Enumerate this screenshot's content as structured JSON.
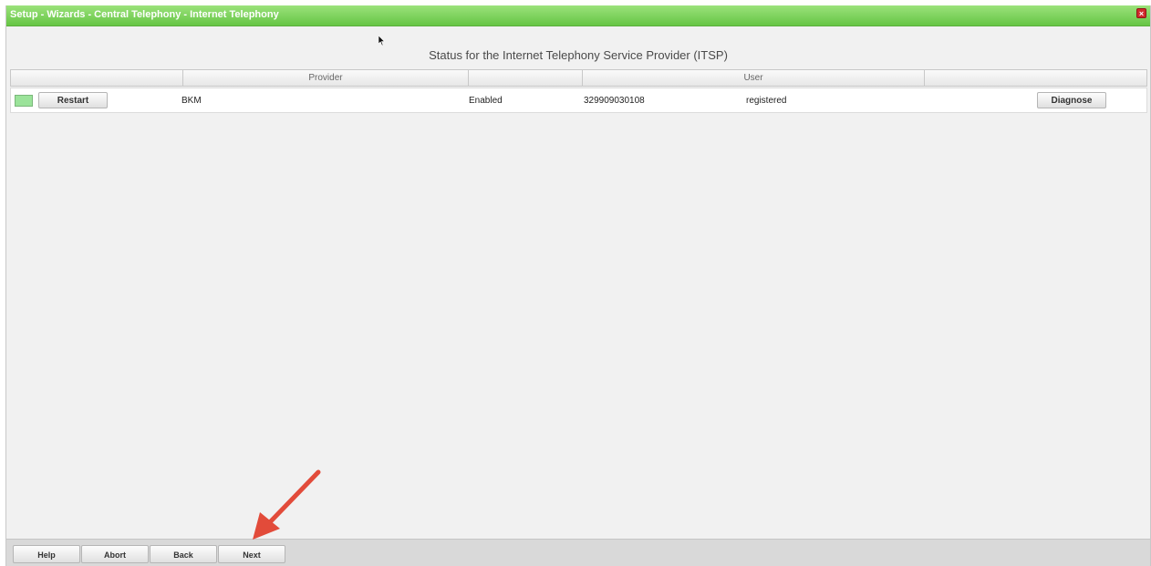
{
  "window": {
    "title": "Setup - Wizards - Central Telephony - Internet Telephony",
    "close_glyph": "×"
  },
  "page": {
    "title": "Status for the Internet Telephony Service Provider (ITSP)"
  },
  "table": {
    "columns": [
      "",
      "Provider",
      "",
      "User",
      ""
    ],
    "rows": [
      {
        "status_color": "#9be39a",
        "restart_label": "Restart",
        "provider": "BKM",
        "state": "Enabled",
        "user": "329909030108",
        "registration": "registered",
        "diagnose_label": "Diagnose"
      }
    ]
  },
  "footer": {
    "buttons": [
      "Help",
      "Abort",
      "Back",
      "Next"
    ]
  },
  "colors": {
    "titlebar": "#66c545",
    "annotation_arrow": "#e24b3a"
  }
}
